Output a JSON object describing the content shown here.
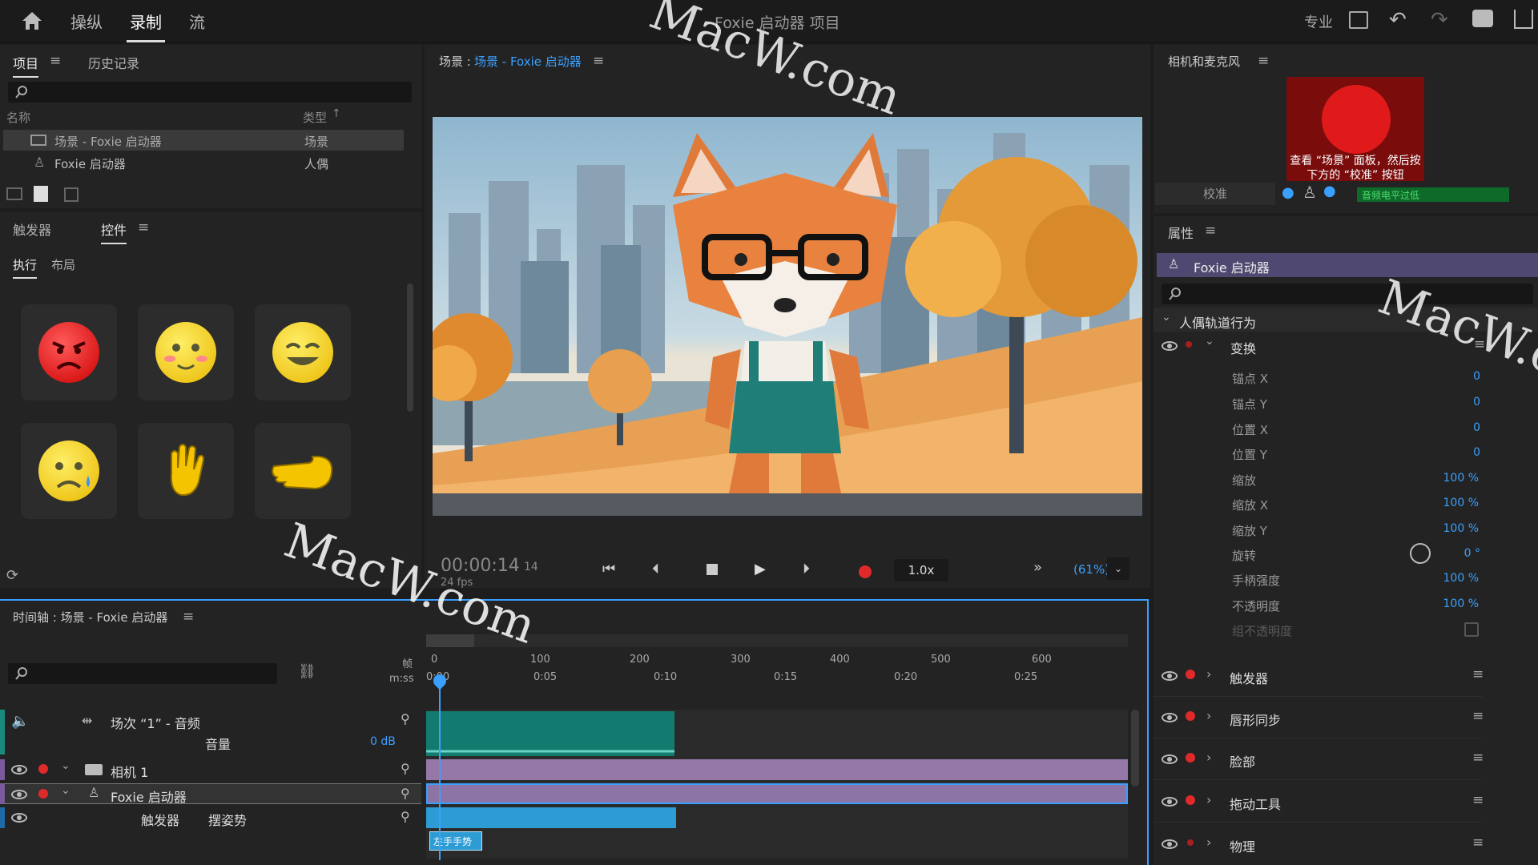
{
  "topbar": {
    "nav": [
      "操纵",
      "录制",
      "流"
    ],
    "active": "录制",
    "project_title": "Foxie 启动器 项目",
    "mode_label": "专业"
  },
  "project_panel": {
    "tabs": [
      "项目",
      "历史记录"
    ],
    "columns": {
      "name": "名称",
      "type": "类型"
    },
    "rows": [
      {
        "name": "场景 - Foxie 启动器",
        "type": "场景"
      },
      {
        "name": "Foxie 启动器",
        "type": "人偶"
      }
    ]
  },
  "controls_panel": {
    "tabs": [
      "触发器",
      "控件"
    ],
    "subtabs": [
      "执行",
      "布局"
    ]
  },
  "scene_panel": {
    "label": "场景 :",
    "scene_name": "场景 - Foxie 启动器",
    "timecode": "00:00:14",
    "frame": "14",
    "fps": "24 fps",
    "speed": "1.0x",
    "zoom": "(61%)"
  },
  "camera_panel": {
    "title": "相机和麦克风",
    "hint": "查看 “场景” 面板，然后按下方的 “校准” 按钮",
    "calibrate": "校准",
    "mic_status": "音频电平过低"
  },
  "properties_panel": {
    "title": "属性",
    "puppet": "Foxie 启动器",
    "group": "人偶轨道行为",
    "transform": "变换",
    "params": [
      {
        "label": "锚点 X",
        "value": "0"
      },
      {
        "label": "锚点 Y",
        "value": "0"
      },
      {
        "label": "位置 X",
        "value": "0"
      },
      {
        "label": "位置 Y",
        "value": "0"
      },
      {
        "label": "缩放",
        "value": "100 %"
      },
      {
        "label": "缩放 X",
        "value": "100 %"
      },
      {
        "label": "缩放 Y",
        "value": "100 %"
      },
      {
        "label": "旋转",
        "value": "0 °"
      },
      {
        "label": "手柄强度",
        "value": "100 %"
      },
      {
        "label": "不透明度",
        "value": "100 %"
      },
      {
        "label": "组不透明度",
        "value": ""
      }
    ],
    "sections": [
      "触发器",
      "唇形同步",
      "脸部",
      "拖动工具",
      "物理"
    ]
  },
  "timeline": {
    "title": "时间轴 : 场景 - Foxie 启动器",
    "frame_label": "帧",
    "time_label": "m:ss",
    "frames": [
      "0",
      "100",
      "200",
      "300",
      "400",
      "500",
      "600"
    ],
    "times": [
      "0:00",
      "0:05",
      "0:10",
      "0:15",
      "0:20",
      "0:25"
    ],
    "tracks": {
      "audio": "场次 “1” - 音频",
      "volume_label": "音量",
      "volume_value": "0 dB",
      "camera": "相机 1",
      "puppet": "Foxie 启动器",
      "trigger": "触发器",
      "pose": "摆姿势",
      "clip": "左手手势"
    }
  },
  "watermark": "MacW.com"
}
